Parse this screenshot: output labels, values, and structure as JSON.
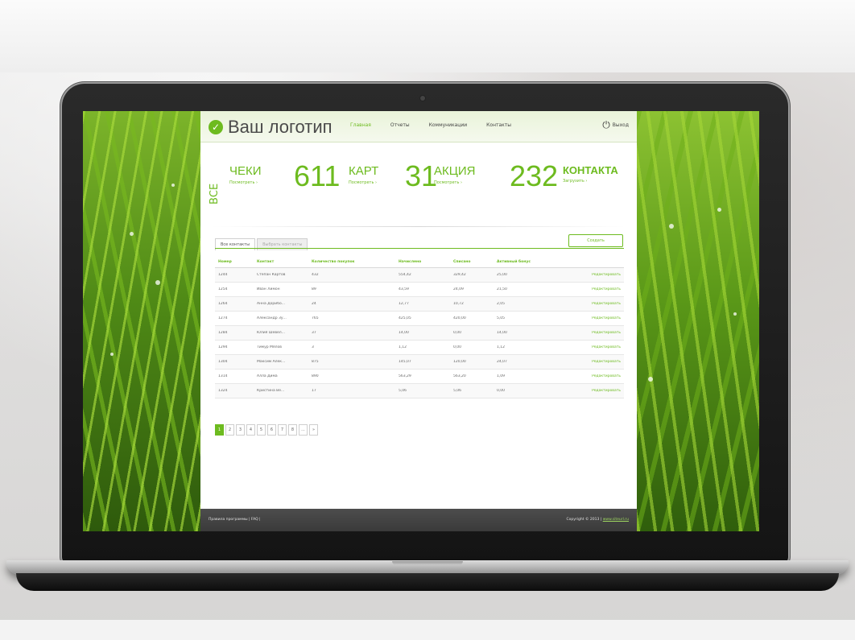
{
  "app": {
    "logo_text": "Ваш логотип",
    "nav": [
      "Главная",
      "Отчеты",
      "Коммуникации",
      "Контакты"
    ],
    "logout_label": "Выход"
  },
  "stats": {
    "all_label": "ВСЕ",
    "items": [
      {
        "label": "ЧЕКИ",
        "sub": "Посмотреть ›"
      },
      {
        "value": "611",
        "label": "КАРТ",
        "sub": "Посмотреть ›"
      },
      {
        "value": "31",
        "label": "АКЦИЯ",
        "sub": "Посмотреть ›"
      },
      {
        "value": "232",
        "label": "КОНТАКТА",
        "sub": "Загрузить ›"
      }
    ]
  },
  "tabs": [
    "Все контакты",
    "Выбрать контакты"
  ],
  "create_button": "Создать",
  "table": {
    "headers": [
      "Номер",
      "Контакт",
      "Количество покупок",
      "Начислено",
      "Списано",
      "Активный бонус",
      ""
    ],
    "rows": [
      [
        "1244",
        "Степан Картов",
        "432",
        "554,42",
        "329,42",
        "25,00",
        "Редактировать"
      ],
      [
        "1254",
        "Иван Лимон",
        "89",
        "43,59",
        "24,09",
        "21,50",
        "Редактировать"
      ],
      [
        "1264",
        "Анна Дорибо...",
        "24",
        "12,77",
        "10,72",
        "2,05",
        "Редактировать"
      ],
      [
        "1274",
        "Александр Зу...",
        "765",
        "425,05",
        "420,00",
        "5,05",
        "Редактировать"
      ],
      [
        "1284",
        "Юлия Шевел...",
        "37",
        "14,00",
        "0,00",
        "14,00",
        "Редактировать"
      ],
      [
        "1294",
        "Тимур Мялов",
        "3",
        "1,12",
        "0,00",
        "1,12",
        "Редактировать"
      ],
      [
        "1304",
        "Максим Алек...",
        "875",
        "145,07",
        "120,00",
        "24,07",
        "Редактировать"
      ],
      [
        "1314",
        "Алла Дима",
        "890",
        "563,29",
        "563,20",
        "1,09",
        "Редактировать"
      ],
      [
        "1324",
        "Кристина Ве...",
        "17",
        "5,06",
        "5,06",
        "0,00",
        "Редактировать"
      ]
    ]
  },
  "pagination": [
    "1",
    "2",
    "3",
    "4",
    "5",
    "6",
    "7",
    "8",
    "...",
    "»"
  ],
  "footer": {
    "left": "Правила программы | FAQ |",
    "right": "Copyright © 2013 |",
    "right_link": "www.siteurl.ru"
  },
  "colors": {
    "accent": "#6dbb1f",
    "footer": "#444444"
  }
}
